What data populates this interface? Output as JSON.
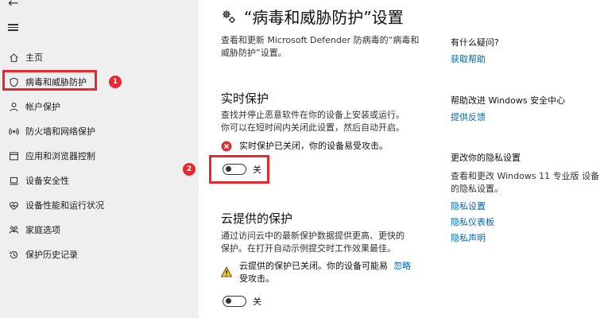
{
  "nav": {
    "back_glyph": "←",
    "items": [
      {
        "label": "主页",
        "icon": "home-icon"
      },
      {
        "label": "病毒和威胁防护",
        "icon": "shield-icon"
      },
      {
        "label": "帐户保护",
        "icon": "person-icon"
      },
      {
        "label": "防火墙和网络保护",
        "icon": "wifi-icon"
      },
      {
        "label": "应用和浏览器控制",
        "icon": "browser-window-icon"
      },
      {
        "label": "设备安全性",
        "icon": "laptop-icon"
      },
      {
        "label": "设备性能和运行状况",
        "icon": "heart-icon"
      },
      {
        "label": "家庭选项",
        "icon": "family-icon"
      },
      {
        "label": "保护历史记录",
        "icon": "history-icon"
      }
    ]
  },
  "annotations": {
    "badge1": "1",
    "badge2": "2"
  },
  "page": {
    "title": "“病毒和威胁防护”设置",
    "desc_line1": "查看和更新 Microsoft Defender 防病毒的“病毒和",
    "desc_line2": "威胁防护”设置。"
  },
  "realtime": {
    "title": "实时保护",
    "desc_line1": "查找并停止恶意软件在你的设备上安装或运行。",
    "desc_line2": "你可以在短时间内关闭此设置，然后自动开启。",
    "status": "实时保护已关闭，你的设备易受攻击。",
    "toggle_label": "关"
  },
  "cloud": {
    "title": "云提供的保护",
    "desc_line1": "通过访问云中的最新保护数据提供更高、更快的",
    "desc_line2": "保护。在打开自动示例提交时工作效果最佳。",
    "status_line1": "云提供的保护已关闭。你的设备可能易",
    "status_link": "忽略",
    "status_line2": "受攻击。",
    "toggle_label": "关"
  },
  "right": {
    "q_heading": "有什么疑问?",
    "q_link": "获取帮助",
    "improve_heading": "帮助改进 Windows 安全中心",
    "improve_link": "提供反馈",
    "privacy_heading": "更改你的隐私设置",
    "privacy_text_line1": "查看和更改 Windows 11 专业版 设备",
    "privacy_text_line2": "的隐私设置。",
    "privacy_links": [
      "隐私设置",
      "隐私仪表板",
      "隐私声明"
    ]
  },
  "colors": {
    "accent_red": "#e8272e",
    "link_blue": "#0067b8",
    "sidebar_bg": "#efefef"
  }
}
